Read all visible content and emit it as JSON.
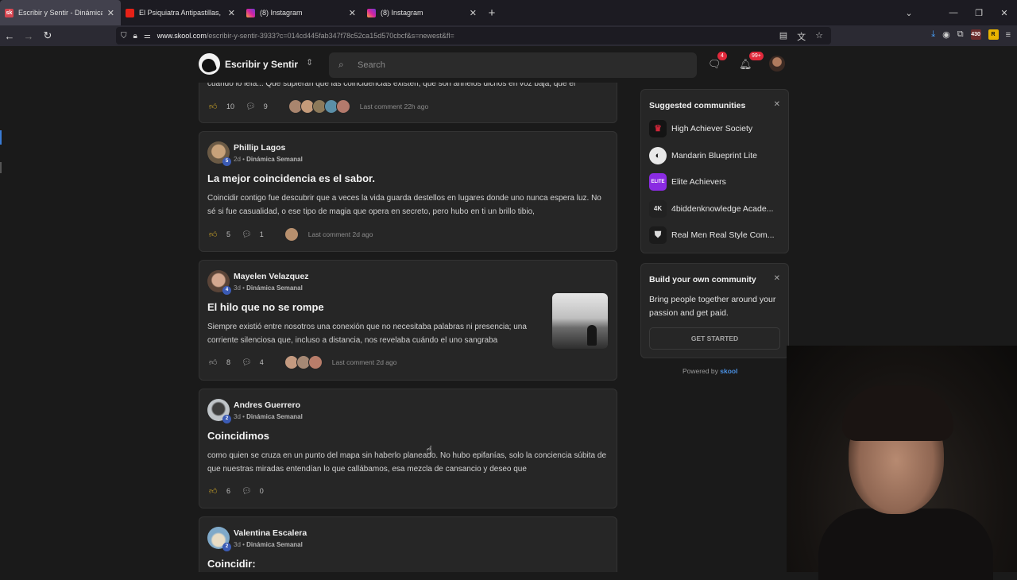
{
  "browser": {
    "tabs": [
      {
        "title": "Escribir y Sentir - Dinámica Semanal",
        "favicon": "skool-favicon",
        "active": true
      },
      {
        "title": "El Psiquiatra Antipastillas, Dr. M",
        "favicon": "youtube-favicon",
        "active": false
      },
      {
        "title": "(8) Instagram",
        "favicon": "instagram-favicon",
        "active": false
      },
      {
        "title": "(8) Instagram",
        "favicon": "instagram-favicon",
        "active": false
      }
    ],
    "url_host": "www.skool.com",
    "url_rest": "/escribir-y-sentir-3933?c=014cd445fab347f78c52ca15d570cbcf&s=newest&fl=",
    "ext_badge": "430"
  },
  "header": {
    "community_name": "Escribir y Sentir",
    "search_placeholder": "Search",
    "chat_badge": "4",
    "notif_badge": "99+"
  },
  "posts": [
    {
      "body": "cuando lo leía... Que supieran que las coincidencias existen, que son anhelos dichos en voz baja, que el",
      "likes": "10",
      "comments": "9",
      "last_comment": "Last comment 22h ago"
    },
    {
      "author": "Phillip Lagos",
      "level": "5",
      "time": "2d",
      "category": "Dinámica Semanal",
      "title": "La mejor coincidencia es el sabor.",
      "body": "Coincidir contigo fue descubrir que a veces la vida guarda destellos en lugares donde uno nunca espera luz. No sé si fue casualidad, o ese tipo de magia que opera en secreto, pero hubo en ti un brillo tibio,",
      "likes": "5",
      "comments": "1",
      "last_comment": "Last comment 2d ago"
    },
    {
      "author": "Mayelen Velazquez",
      "level": "4",
      "time": "3d",
      "category": "Dinámica Semanal",
      "title": "El hilo que no se rompe",
      "body": "Siempre existió entre nosotros una conexión que no necesitaba palabras ni presencia; una corriente silenciosa que, incluso a distancia, nos revelaba cuándo el uno sangraba",
      "likes": "8",
      "comments": "4",
      "last_comment": "Last comment 2d ago"
    },
    {
      "author": "Andres Guerrero",
      "level": "2",
      "time": "3d",
      "category": "Dinámica Semanal",
      "title": "Coincidimos",
      "body": "como quien se cruza en un punto del mapa sin haberlo planeado. No hubo epifanías, solo la conciencia súbita de que nuestras miradas entendían lo que callábamos, esa mezcla de cansancio y deseo que",
      "likes": "6",
      "comments": "0"
    },
    {
      "author": "Valentina Escalera",
      "level": "2",
      "time": "3d",
      "category": "Dinámica Semanal",
      "title": "Coincidir:"
    }
  ],
  "sidebar": {
    "suggested_title": "Suggested communities",
    "communities": [
      {
        "name": "High Achiever Society",
        "icon": "crown-logo",
        "color": "#b01c2e"
      },
      {
        "name": "Mandarin Blueprint Lite",
        "icon": "mb-logo",
        "color": "#e8e8e8"
      },
      {
        "name": "Elite Achievers",
        "icon": "elite-logo",
        "color": "#8a2be2",
        "icon_text": "ELITE"
      },
      {
        "name": "4biddenknowledge Acade...",
        "icon": "4bk-logo",
        "color": "#222222",
        "icon_text": "4K"
      },
      {
        "name": "Real Men Real Style Com...",
        "icon": "rmrs-logo",
        "color": "#1b1b1b"
      }
    ],
    "build_title": "Build your own community",
    "build_text": "Bring people together around your passion and get paid.",
    "get_started": "GET STARTED",
    "powered_by": "Powered by",
    "skool": "skool"
  }
}
